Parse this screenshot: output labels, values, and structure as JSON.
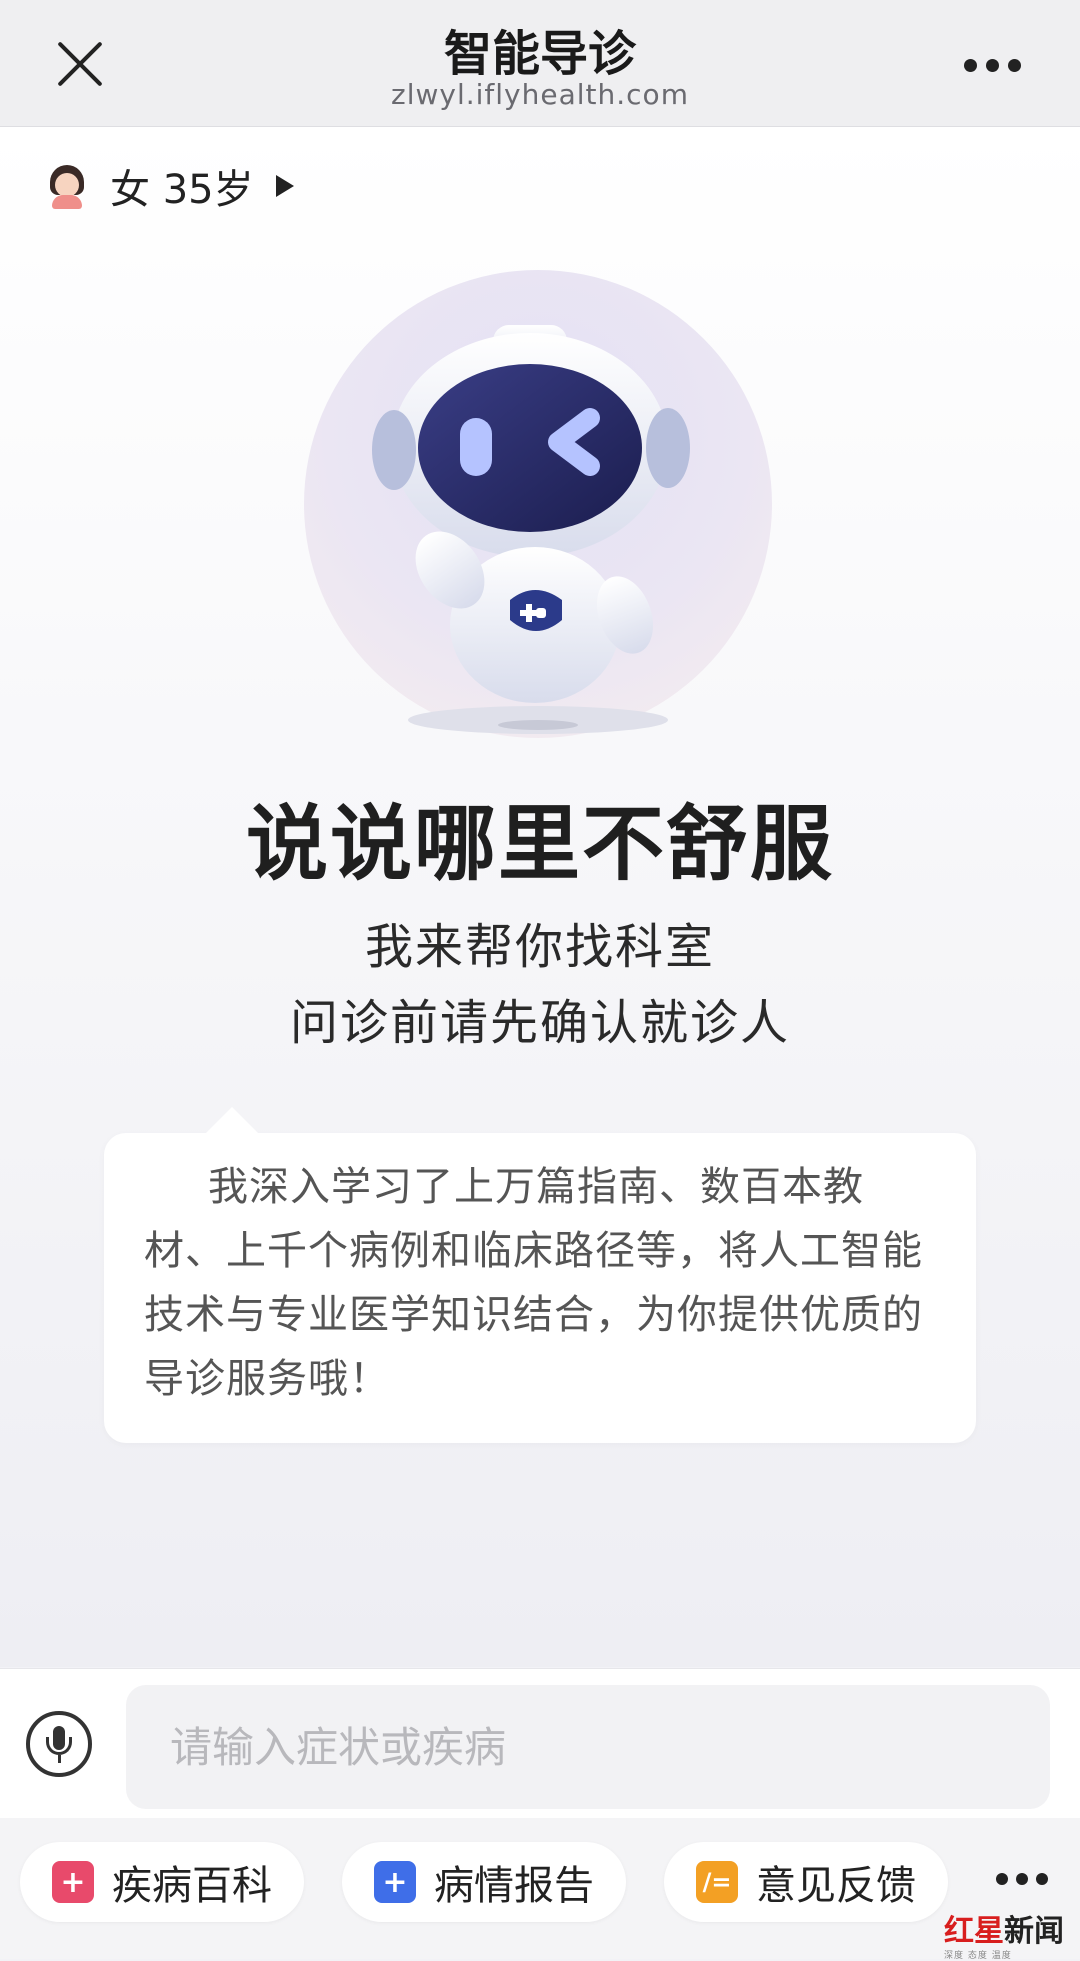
{
  "header": {
    "title": "智能导诊",
    "url": "zlwyl.iflyhealth.com"
  },
  "patient": {
    "text": "女 35岁"
  },
  "main": {
    "headline": "说说哪里不舒服",
    "subtitle_1": "我来帮你找科室",
    "subtitle_2": "问诊前请先确认就诊人",
    "bubble_text": "我深入学习了上万篇指南、数百本教材、上千个病例和临床路径等，将人工智能技术与专业医学知识结合，为你提供优质的导诊服务哦！"
  },
  "input": {
    "placeholder": "请输入症状或疾病",
    "value": ""
  },
  "toolbar": {
    "items": [
      {
        "label": "疾病百科",
        "icon": "book-plus-icon",
        "color": "#e84a6b"
      },
      {
        "label": "病情报告",
        "icon": "plus-icon",
        "color": "#3f6ee8"
      },
      {
        "label": "意见反馈",
        "icon": "edit-icon",
        "color": "#f3a024"
      }
    ]
  },
  "watermark": {
    "brand_part1": "红星",
    "brand_part2": "新闻",
    "tagline": "深度 态度 温度"
  },
  "colors": {
    "accent_blue": "#3f6ee8",
    "accent_red": "#e84a6b",
    "accent_orange": "#f3a024"
  }
}
